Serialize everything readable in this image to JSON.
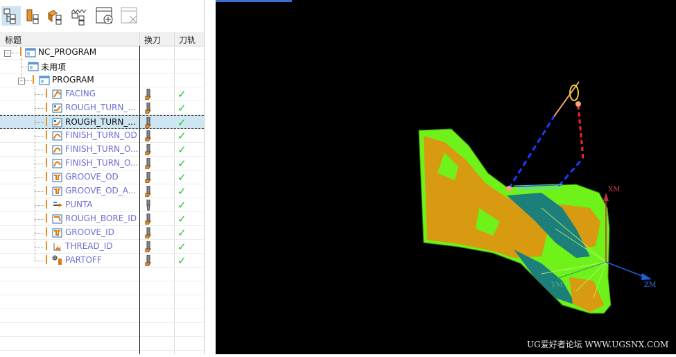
{
  "toolbar": {
    "buttons": [
      {
        "name": "program-order-view-button",
        "icon": "program-order-view-icon",
        "active": true
      },
      {
        "name": "machine-tool-view-button",
        "icon": "machine-tool-view-icon",
        "active": false
      },
      {
        "name": "geometry-view-button",
        "icon": "geometry-view-icon",
        "active": false
      },
      {
        "name": "machining-method-view-button",
        "icon": "machining-method-view-icon",
        "active": false
      },
      {
        "name": "create-operation-button",
        "icon": "create-operation-icon",
        "active": false
      },
      {
        "name": "delete-operation-button",
        "icon": "delete-operation-icon",
        "active": false
      }
    ]
  },
  "navigator": {
    "columns": {
      "name": "标题",
      "tool_change": "换刀",
      "toolpath": "刀轨"
    },
    "rows": [
      {
        "label": "NC_PROGRAM",
        "type": "root",
        "icon": "program-group-icon",
        "tool": false,
        "path": false
      },
      {
        "label": "未用项",
        "type": "group",
        "icon": "program-group-icon",
        "tool": false,
        "path": false
      },
      {
        "label": "PROGRAM",
        "type": "group",
        "icon": "program-group-icon",
        "tool": false,
        "path": false
      },
      {
        "label": "FACING",
        "type": "op",
        "icon": "facing-op-icon",
        "tool": true,
        "path": true
      },
      {
        "label": "ROUGH_TURN_...",
        "type": "op",
        "icon": "rough-turn-op-icon",
        "tool": true,
        "path": true
      },
      {
        "label": "ROUGH_TURN_...",
        "type": "op",
        "icon": "rough-turn-op-icon",
        "tool": true,
        "path": true,
        "selected": true
      },
      {
        "label": "FINISH_TURN_OD",
        "type": "op",
        "icon": "finish-turn-op-icon",
        "tool": true,
        "path": true
      },
      {
        "label": "FINISH_TURN_O...",
        "type": "op",
        "icon": "finish-turn-op-icon",
        "tool": true,
        "path": true
      },
      {
        "label": "FINISH_TURN_O...",
        "type": "op",
        "icon": "finish-turn-op-icon",
        "tool": true,
        "path": true
      },
      {
        "label": "GROOVE_OD",
        "type": "op",
        "icon": "groove-op-icon",
        "tool": true,
        "path": true
      },
      {
        "label": "GROOVE_OD_A...",
        "type": "op",
        "icon": "groove-op-icon",
        "tool": true,
        "path": true
      },
      {
        "label": "PUNTA",
        "type": "op",
        "icon": "drill-op-icon",
        "tool": true,
        "path": true
      },
      {
        "label": "ROUGH_BORE_ID",
        "type": "op",
        "icon": "rough-bore-op-icon",
        "tool": true,
        "path": true
      },
      {
        "label": "GROOVE_ID",
        "type": "op",
        "icon": "groove-op-icon",
        "tool": true,
        "path": true
      },
      {
        "label": "THREAD_ID",
        "type": "op",
        "icon": "thread-op-icon",
        "tool": true,
        "path": true
      },
      {
        "label": "PARTOFF",
        "type": "op",
        "icon": "partoff-op-icon",
        "tool": true,
        "path": true
      }
    ]
  },
  "graphics": {
    "axes": {
      "x": "XM",
      "z": "ZM",
      "y": "YM"
    },
    "watermark": "UG爱好者论坛 WWW.UGSNX.COM"
  },
  "colors": {
    "part_green": "#6ef21a",
    "part_orange": "#d89a10",
    "part_teal": "#1c7f7a",
    "axis_x": "#c0303a",
    "axis_z": "#2060e0",
    "path_blue": "#1a3cff",
    "path_red": "#ff2020",
    "tool": "#f0a070"
  }
}
